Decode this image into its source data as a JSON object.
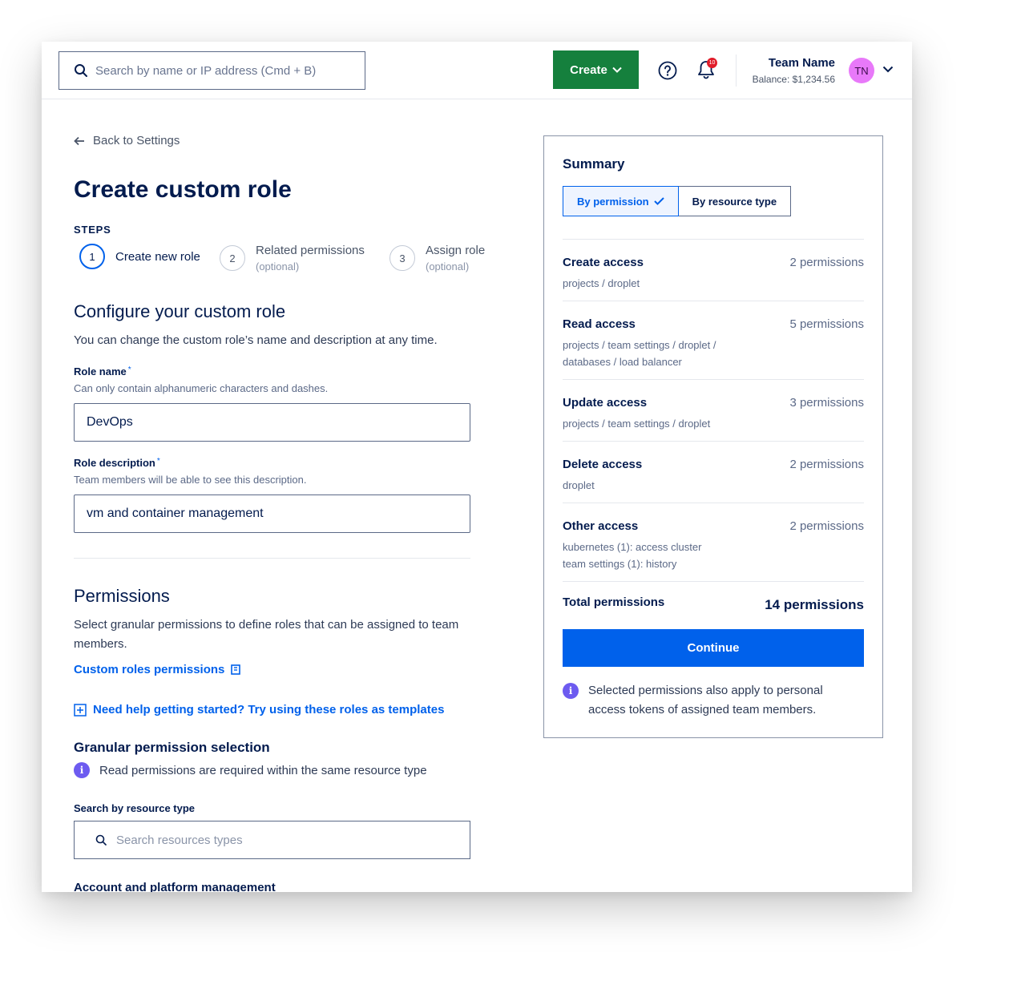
{
  "topbar": {
    "search_placeholder": "Search by name or IP address (Cmd + B)",
    "create_label": "Create",
    "notifications_count": "10",
    "team_name": "Team Name",
    "balance": "Balance: $1,234.56",
    "avatar_initials": "TN"
  },
  "nav": {
    "back_label": "Back to Settings"
  },
  "page": {
    "title": "Create custom role"
  },
  "steps": {
    "label": "STEPS",
    "items": [
      {
        "number": "1",
        "title": "Create new role",
        "sub": ""
      },
      {
        "number": "2",
        "title": "Related permissions",
        "sub": "(optional)"
      },
      {
        "number": "3",
        "title": "Assign role",
        "sub": "(optional)"
      }
    ]
  },
  "configure": {
    "heading": "Configure your custom role",
    "intro": "You can change the custom role’s name and description at any time.",
    "role_name": {
      "label": "Role name",
      "required_mark": "*",
      "help": "Can only contain alphanumeric characters and dashes.",
      "value": "DevOps"
    },
    "role_description": {
      "label": "Role description",
      "required_mark": "*",
      "help": "Team members will be able to see this description.",
      "value": "vm and container management"
    }
  },
  "permissions": {
    "heading": "Permissions",
    "intro": "Select granular permissions to define roles that can be assigned to team members.",
    "docs_link": "Custom roles permissions",
    "templates_link": "Need help getting started? Try using these roles as templates",
    "granular_heading": "Granular permission selection",
    "granular_note": "Read permissions are required within the same resource type",
    "search_label": "Search by resource type",
    "search_placeholder": "Search resources types",
    "first_group": "Account and platform management"
  },
  "summary": {
    "title": "Summary",
    "toggle": {
      "by_permission": "By permission",
      "by_resource_type": "By resource type",
      "selected": "by_permission"
    },
    "rows": [
      {
        "title": "Create access",
        "count": "2 permissions",
        "detail": "projects / droplet"
      },
      {
        "title": "Read access",
        "count": "5 permissions",
        "detail": "projects / team settings / droplet / databases / load balancer"
      },
      {
        "title": "Update access",
        "count": "3 permissions",
        "detail": "projects / team settings / droplet"
      },
      {
        "title": "Delete access",
        "count": "2 permissions",
        "detail": "droplet"
      },
      {
        "title": "Other access",
        "count": "2 permissions",
        "detail_line1": "kubernetes (1): access cluster",
        "detail_line2": "team settings (1): history"
      }
    ],
    "total_label": "Total permissions",
    "total_value": "14 permissions",
    "continue_label": "Continue",
    "note": "Selected permissions also apply to personal access tokens of assigned team members."
  },
  "colors": {
    "primary": "#0061eb",
    "create_button": "#15803d",
    "text_dark": "#031b4e",
    "info_icon": "#6d5bf0",
    "avatar": "#e879f9",
    "badge": "#e11d2a"
  },
  "icons": [
    "search-icon",
    "chevron-down-icon",
    "help-icon",
    "bell-icon",
    "arrow-left-icon",
    "check-icon",
    "info-icon",
    "book-icon",
    "plus-square-icon"
  ]
}
